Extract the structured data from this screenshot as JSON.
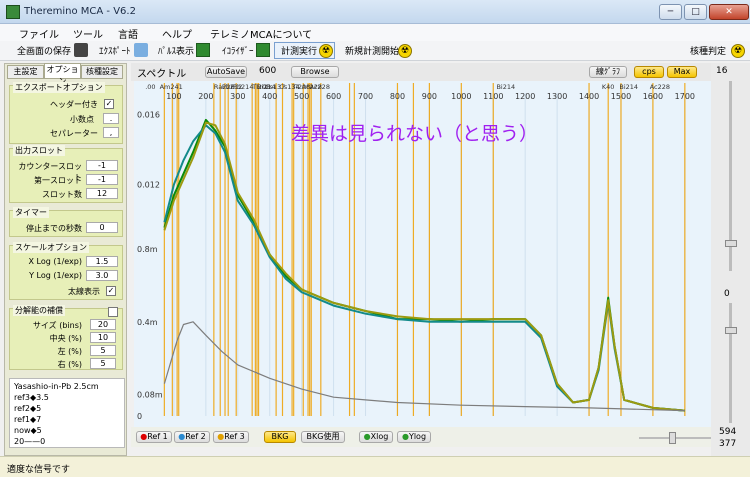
{
  "window": {
    "title": "Theremino MCA - V6.2",
    "btn_min": "─",
    "btn_max": "□",
    "btn_close": "✕"
  },
  "menu": [
    "ファイル",
    "ツール",
    "言語",
    "ヘルプ",
    "テレミノMCAについて"
  ],
  "toolbar": {
    "save": "全画面の保存",
    "export": "ｴｸｽﾎﾟｰﾄ",
    "pulse": "ﾊﾟﾙｽ表示",
    "equalizer": "ｲｺﾗｲｻﾞｰ",
    "run": "計測実行",
    "new_run": "新規計測開始",
    "nuclide": "核種判定"
  },
  "tabs": [
    "主設定",
    "オプション",
    "核種設定"
  ],
  "export_options": {
    "title": "エクスポートオプション",
    "header": "ヘッダー付き",
    "header_checked": "✓",
    "decimal": "小数点",
    "decimal_val": ".",
    "separator": "セパレーター",
    "separator_val": ","
  },
  "output_slots": {
    "title": "出力スロット",
    "counter": "カウンタースロット",
    "counter_val": "-1",
    "first": "第一スロット",
    "first_val": "-1",
    "slots": "スロット数",
    "slots_val": "12"
  },
  "timer": {
    "title": "タイマー",
    "stop": "停止までの秒数",
    "stop_val": "0"
  },
  "scale": {
    "title": "スケールオプション",
    "xlog": "X Log (1/exp)",
    "xlog_val": "1.5",
    "ylog": "Y Log (1/exp)",
    "ylog_val": "3.0",
    "thick": "太線表示",
    "thick_checked": "✓"
  },
  "resolution": {
    "title": "分解能の補償",
    "size": "サイズ (bins)",
    "size_val": "20",
    "center": "中央 (%)",
    "center_val": "10",
    "left": "左 (%)",
    "left_val": "5",
    "right": "右 (%)",
    "right_val": "5"
  },
  "notes": [
    "Yasashio-in-Pb  2.5cm",
    "ref3◆3.5",
    "ref2◆5",
    "ref1◆7",
    "now◆5",
    "20——0"
  ],
  "status": "適度な信号です",
  "chart_header": {
    "label": "スペクトル",
    "autosave": "AutoSave",
    "autosave_val": "600",
    "browse": "Browse",
    "linegraph": "線ｸﾞﾗﾌ",
    "cps": "cps",
    "max": "Max"
  },
  "annotation": "差異は見られない（と思う）",
  "bottom": {
    "ref1": "Ref 1",
    "ref2": "Ref 2",
    "ref3": "Ref 3",
    "bkg": "BKG",
    "bkg_use": "BKG使用",
    "xlog": "Xlog",
    "ylog": "Ylog"
  },
  "right": {
    "top": "16",
    "mid": "0",
    "v1": "594",
    "v2": "377"
  },
  "colors": {
    "green": "#0a8a0a",
    "teal": "#138a8a",
    "olive": "#9c9a10",
    "gray": "#7d7d7d",
    "orange": "#f0a000",
    "bg": "#e9f3fb"
  },
  "chart_data": {
    "type": "line",
    "xlabel": "",
    "ylabel": "",
    "x_ticks": [
      100,
      200,
      300,
      400,
      500,
      600,
      700,
      800,
      900,
      1000,
      1100,
      1200,
      1300,
      1400,
      1500,
      1600,
      1700
    ],
    "y_ticks": [
      "0",
      "0.08m",
      "0.4m",
      "0.8m",
      "0.012",
      "0.016"
    ],
    "isotope_labels": [
      ".00",
      "Am241",
      "Ra226",
      "Pb212",
      "Pb214",
      "Tl208",
      "Bi214",
      "Cs137",
      "Cs134",
      "Tl208",
      "Ac228",
      "Ac228",
      "Bi214",
      "K40",
      "Bi214",
      "Ac228"
    ],
    "series": [
      {
        "name": "",
        "color": "#0a8a0a",
        "points": [
          [
            70,
            0.7
          ],
          [
            100,
            0.82
          ],
          [
            130,
            0.9
          ],
          [
            160,
            0.98
          ],
          [
            200,
            1.1
          ],
          [
            230,
            1.06
          ],
          [
            260,
            1.0
          ],
          [
            300,
            0.82
          ],
          [
            350,
            0.72
          ],
          [
            400,
            0.6
          ],
          [
            450,
            0.52
          ],
          [
            500,
            0.47
          ],
          [
            600,
            0.42
          ],
          [
            700,
            0.39
          ],
          [
            800,
            0.36
          ],
          [
            900,
            0.36
          ],
          [
            1000,
            0.35
          ],
          [
            1100,
            0.36
          ],
          [
            1200,
            0.36
          ],
          [
            1250,
            0.3
          ],
          [
            1300,
            0.12
          ],
          [
            1350,
            0.05
          ],
          [
            1400,
            0.06
          ],
          [
            1430,
            0.18
          ],
          [
            1460,
            0.44
          ],
          [
            1480,
            0.26
          ],
          [
            1510,
            0.06
          ],
          [
            1600,
            0.03
          ],
          [
            1700,
            0.02
          ]
        ]
      },
      {
        "name": "",
        "color": "#138a8a",
        "points": [
          [
            70,
            0.72
          ],
          [
            100,
            0.86
          ],
          [
            130,
            0.95
          ],
          [
            160,
            1.02
          ],
          [
            200,
            1.08
          ],
          [
            230,
            1.05
          ],
          [
            260,
            0.98
          ],
          [
            300,
            0.8
          ],
          [
            350,
            0.71
          ],
          [
            400,
            0.59
          ],
          [
            450,
            0.51
          ],
          [
            500,
            0.46
          ],
          [
            600,
            0.41
          ],
          [
            700,
            0.38
          ],
          [
            800,
            0.36
          ],
          [
            900,
            0.35
          ],
          [
            1000,
            0.35
          ],
          [
            1100,
            0.35
          ],
          [
            1200,
            0.35
          ],
          [
            1250,
            0.29
          ],
          [
            1300,
            0.11
          ],
          [
            1350,
            0.05
          ],
          [
            1400,
            0.06
          ],
          [
            1430,
            0.17
          ],
          [
            1460,
            0.42
          ],
          [
            1480,
            0.25
          ],
          [
            1510,
            0.06
          ],
          [
            1600,
            0.03
          ],
          [
            1700,
            0.02
          ]
        ]
      },
      {
        "name": "",
        "color": "#9c9a10",
        "points": [
          [
            70,
            0.69
          ],
          [
            100,
            0.8
          ],
          [
            130,
            0.88
          ],
          [
            160,
            0.96
          ],
          [
            200,
            1.09
          ],
          [
            230,
            1.08
          ],
          [
            260,
            1.01
          ],
          [
            300,
            0.83
          ],
          [
            350,
            0.73
          ],
          [
            400,
            0.6
          ],
          [
            450,
            0.53
          ],
          [
            500,
            0.47
          ],
          [
            600,
            0.42
          ],
          [
            700,
            0.39
          ],
          [
            800,
            0.37
          ],
          [
            900,
            0.36
          ],
          [
            1000,
            0.36
          ],
          [
            1100,
            0.36
          ],
          [
            1200,
            0.36
          ],
          [
            1250,
            0.3
          ],
          [
            1300,
            0.12
          ],
          [
            1350,
            0.05
          ],
          [
            1400,
            0.06
          ],
          [
            1430,
            0.18
          ],
          [
            1460,
            0.43
          ],
          [
            1480,
            0.26
          ],
          [
            1510,
            0.06
          ],
          [
            1600,
            0.03
          ],
          [
            1700,
            0.02
          ]
        ]
      },
      {
        "name": "",
        "color": "#7d7d7d",
        "points": [
          [
            70,
            0.12
          ],
          [
            90,
            0.2
          ],
          [
            110,
            0.28
          ],
          [
            130,
            0.34
          ],
          [
            160,
            0.35
          ],
          [
            200,
            0.3
          ],
          [
            250,
            0.24
          ],
          [
            300,
            0.19
          ],
          [
            400,
            0.14
          ],
          [
            500,
            0.1
          ],
          [
            600,
            0.07
          ],
          [
            700,
            0.06
          ],
          [
            800,
            0.05
          ],
          [
            1000,
            0.04
          ],
          [
            1200,
            0.035
          ],
          [
            1400,
            0.03
          ],
          [
            1700,
            0.02
          ]
        ]
      }
    ],
    "markers": [
      70,
      95,
      110,
      115,
      225,
      245,
      260,
      270,
      295,
      345,
      355,
      360,
      365,
      420,
      440,
      470,
      475,
      505,
      520,
      525,
      530,
      560,
      650,
      665,
      800,
      850,
      900,
      1000,
      1100,
      1400,
      1460,
      1500,
      1600,
      1700
    ]
  }
}
